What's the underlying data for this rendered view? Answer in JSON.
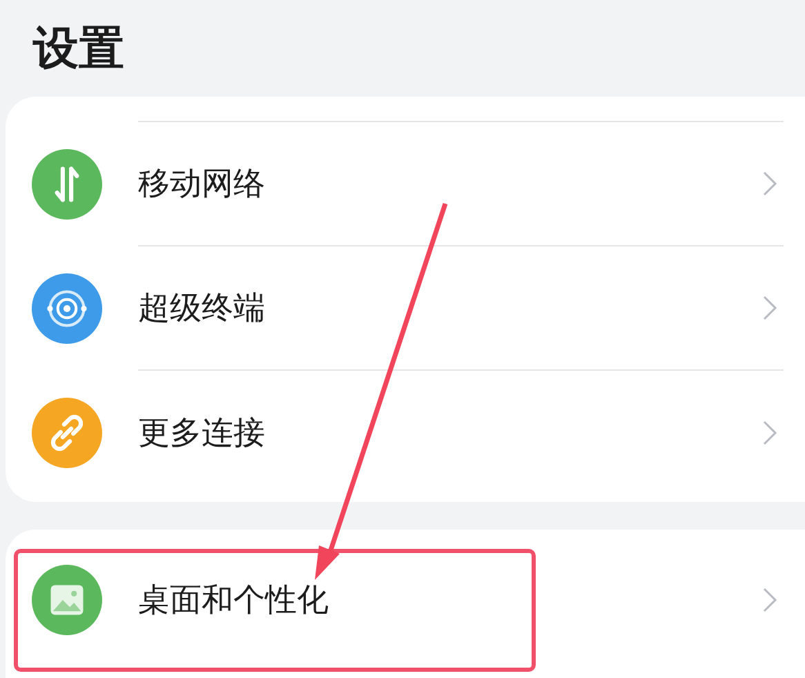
{
  "title": "设置",
  "groups": [
    {
      "items": [
        {
          "label": "移动网络",
          "kind": "network",
          "color": "#5cb85c"
        },
        {
          "label": "超级终端",
          "kind": "device",
          "color": "#3d9be9"
        },
        {
          "label": "更多连接",
          "kind": "link",
          "color": "#f5a623"
        }
      ]
    },
    {
      "items": [
        {
          "label": "桌面和个性化",
          "kind": "picture",
          "color": "#5cb85c"
        }
      ]
    }
  ]
}
